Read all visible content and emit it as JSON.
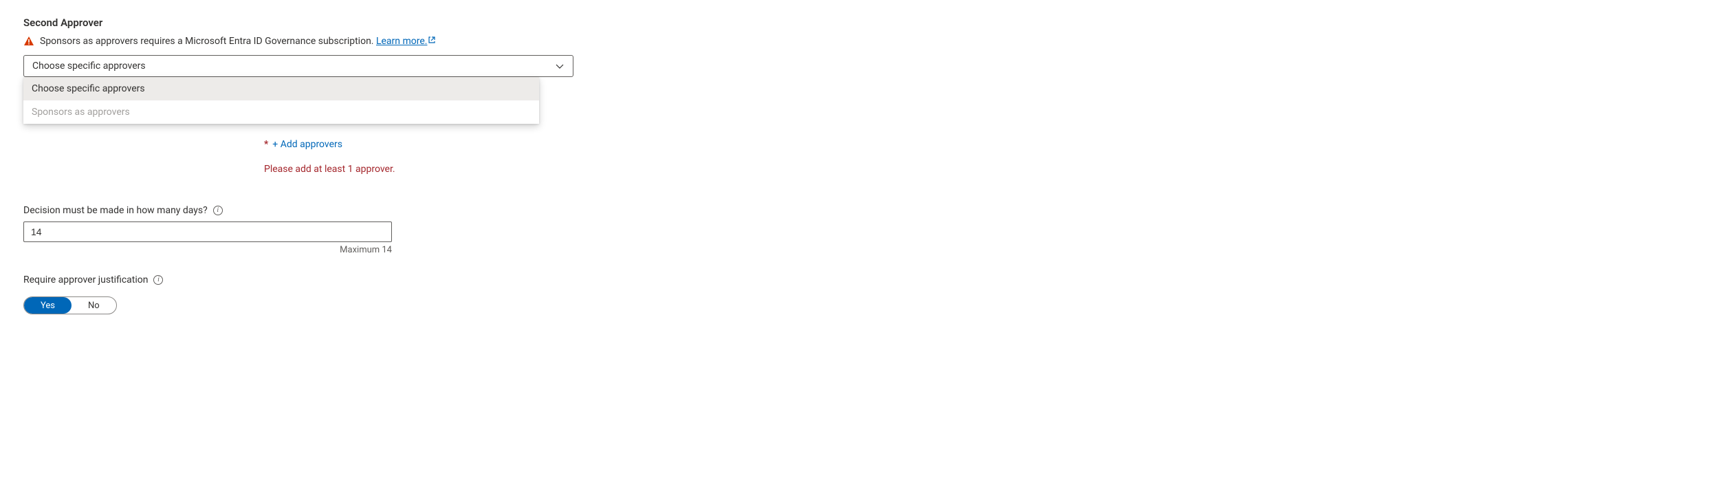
{
  "section": {
    "title": "Second Approver"
  },
  "warning": {
    "text": "Sponsors as approvers requires a Microsoft Entra ID Governance subscription. ",
    "link_text": "Learn more."
  },
  "approver_dropdown": {
    "selected": "Choose specific approvers",
    "options": [
      {
        "label": "Choose specific approvers",
        "selected": true,
        "disabled": false
      },
      {
        "label": "Sponsors as approvers",
        "selected": false,
        "disabled": true
      }
    ]
  },
  "add_approvers": {
    "asterisk": "*",
    "link": "+ Add approvers",
    "error": "Please add at least 1 approver."
  },
  "decision_days": {
    "label": "Decision must be made in how many days?",
    "value": "14",
    "helper": "Maximum 14"
  },
  "require_justification": {
    "label": "Require approver justification",
    "yes": "Yes",
    "no": "No"
  }
}
